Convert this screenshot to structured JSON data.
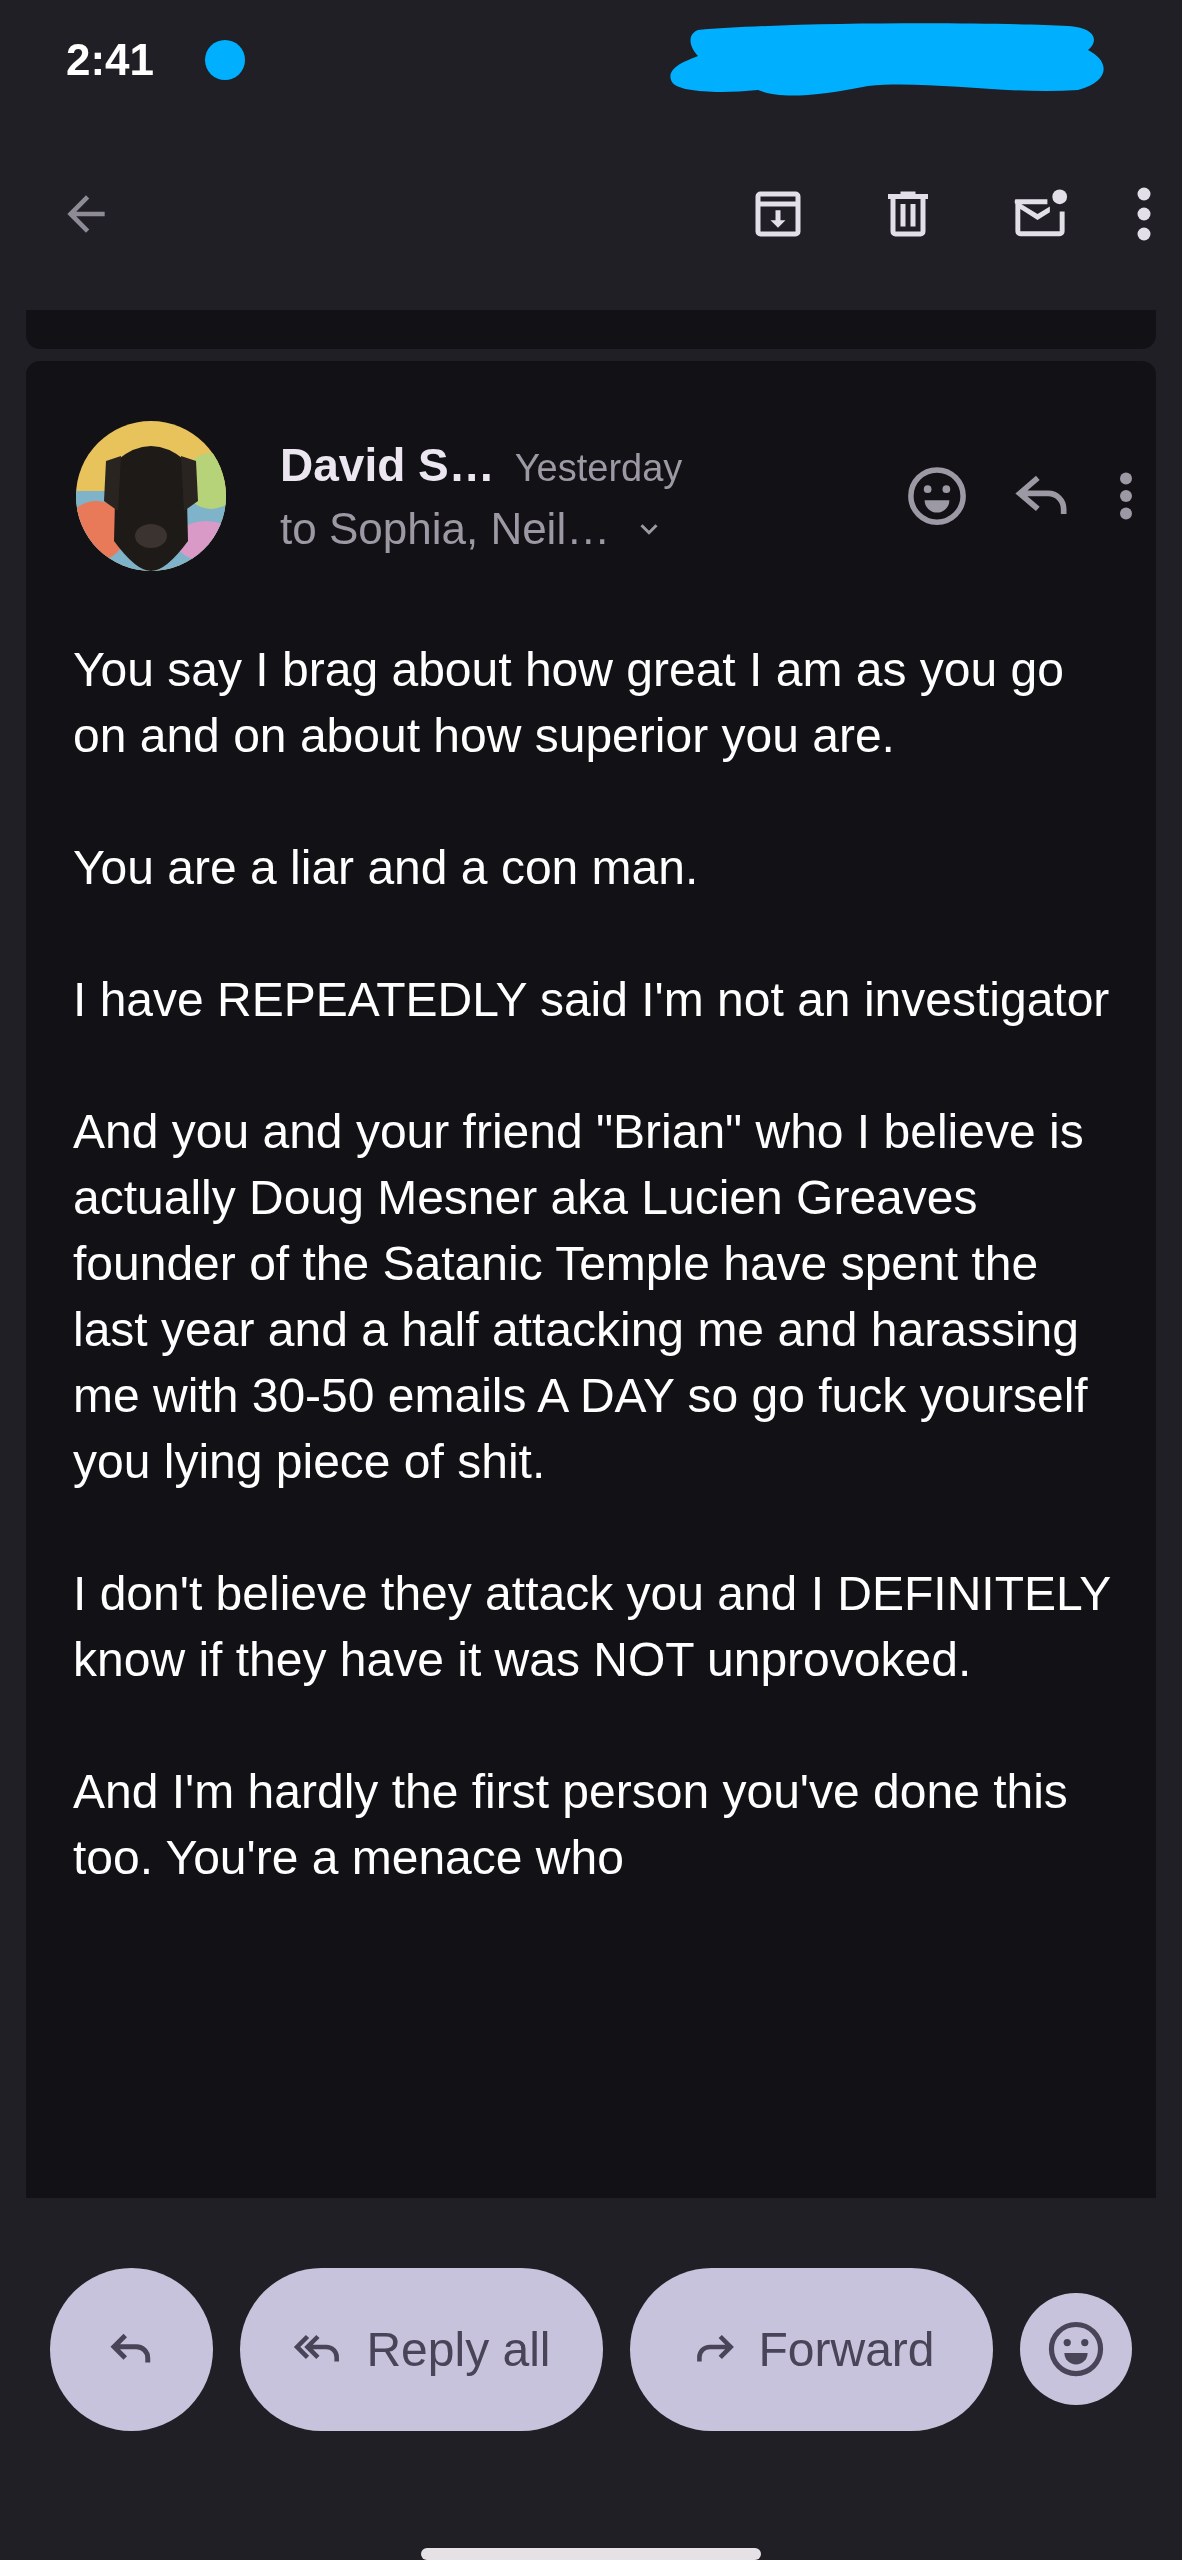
{
  "status_bar": {
    "time": "2:41"
  },
  "message": {
    "sender": "David S…",
    "date": "Yesterday",
    "recipients": "to Sophia, Neil…",
    "body": [
      "You say I brag about how great I am as you go on and on about how superior you are.",
      "You are a liar and a con man.",
      "I have REPEATEDLY said I'm not an investigator",
      "And you and your friend \"Brian\" who I believe is actually Doug Mesner aka Lucien Greaves founder of the Satanic Temple have spent the last year and a half attacking me and harassing me with 30-50 emails A DAY so go fuck yourself you lying piece of shit.",
      "I don't believe they attack you and I DEFINITELY know if they have it was NOT unprovoked.",
      "And I'm hardly the first person you've done this too. You're a menace who"
    ]
  },
  "actions": [
    {
      "kind": "reply"
    },
    {
      "kind": "reply_all",
      "label": "Reply all"
    },
    {
      "kind": "forward",
      "label": "Forward"
    },
    {
      "kind": "react"
    }
  ]
}
